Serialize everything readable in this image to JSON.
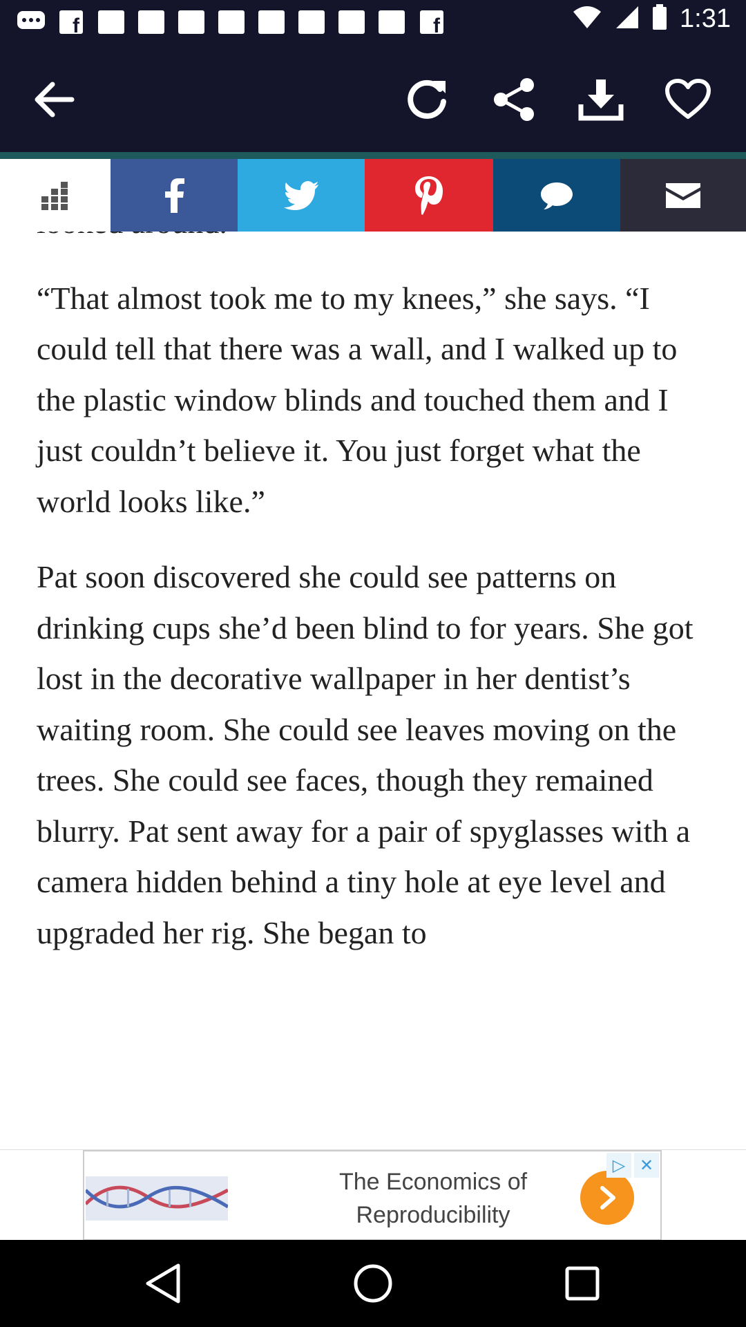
{
  "status_bar": {
    "time": "1:31",
    "notification_icons": [
      "message-icon",
      "facebook-icon",
      "square-icon",
      "square-icon",
      "square-icon",
      "square-icon",
      "square-icon",
      "square-icon",
      "square-icon",
      "square-icon",
      "facebook-icon"
    ]
  },
  "app_bar": {
    "icons": [
      "back-arrow-icon",
      "refresh-icon",
      "share-icon",
      "download-icon",
      "heart-icon"
    ]
  },
  "share_bar": {
    "items": [
      {
        "name": "apps-grid",
        "icon": "grid-icon",
        "color": "#ffffff"
      },
      {
        "name": "facebook",
        "icon": "f",
        "color": "#3b5998"
      },
      {
        "name": "twitter",
        "icon": "twitter-bird-icon",
        "color": "#2eaae1"
      },
      {
        "name": "pinterest",
        "icon": "P",
        "color": "#e0262f"
      },
      {
        "name": "sms",
        "icon": "speech-bubble-icon",
        "color": "#0c4a78"
      },
      {
        "name": "email",
        "icon": "envelope-icon",
        "color": "#2b2b3a"
      }
    ]
  },
  "article": {
    "paragraphs": [
      "looked around.",
      "“That almost took me to my knees,” she says. “I could tell that there was a wall, and I walked up to the plastic window blinds and touched them and I just couldn’t believe it. You just forget what the world looks like.”",
      "Pat soon discovered she could see patterns on drinking cups she’d been blind to for years. She got lost in the decorative wallpaper in her dentist’s waiting room. She could see leaves moving on the trees. She could see faces, though they remained blurry. Pat sent away for a pair of spyglasses with a camera hidden behind a tiny hole at eye level and upgraded her rig. She began to"
    ]
  },
  "ad": {
    "line1": "The Economics of",
    "line2": "Reproducibility"
  },
  "colors": {
    "navy": "#14142a",
    "accent": "#1e5a5c",
    "ad_arrow": "#f7941d"
  }
}
